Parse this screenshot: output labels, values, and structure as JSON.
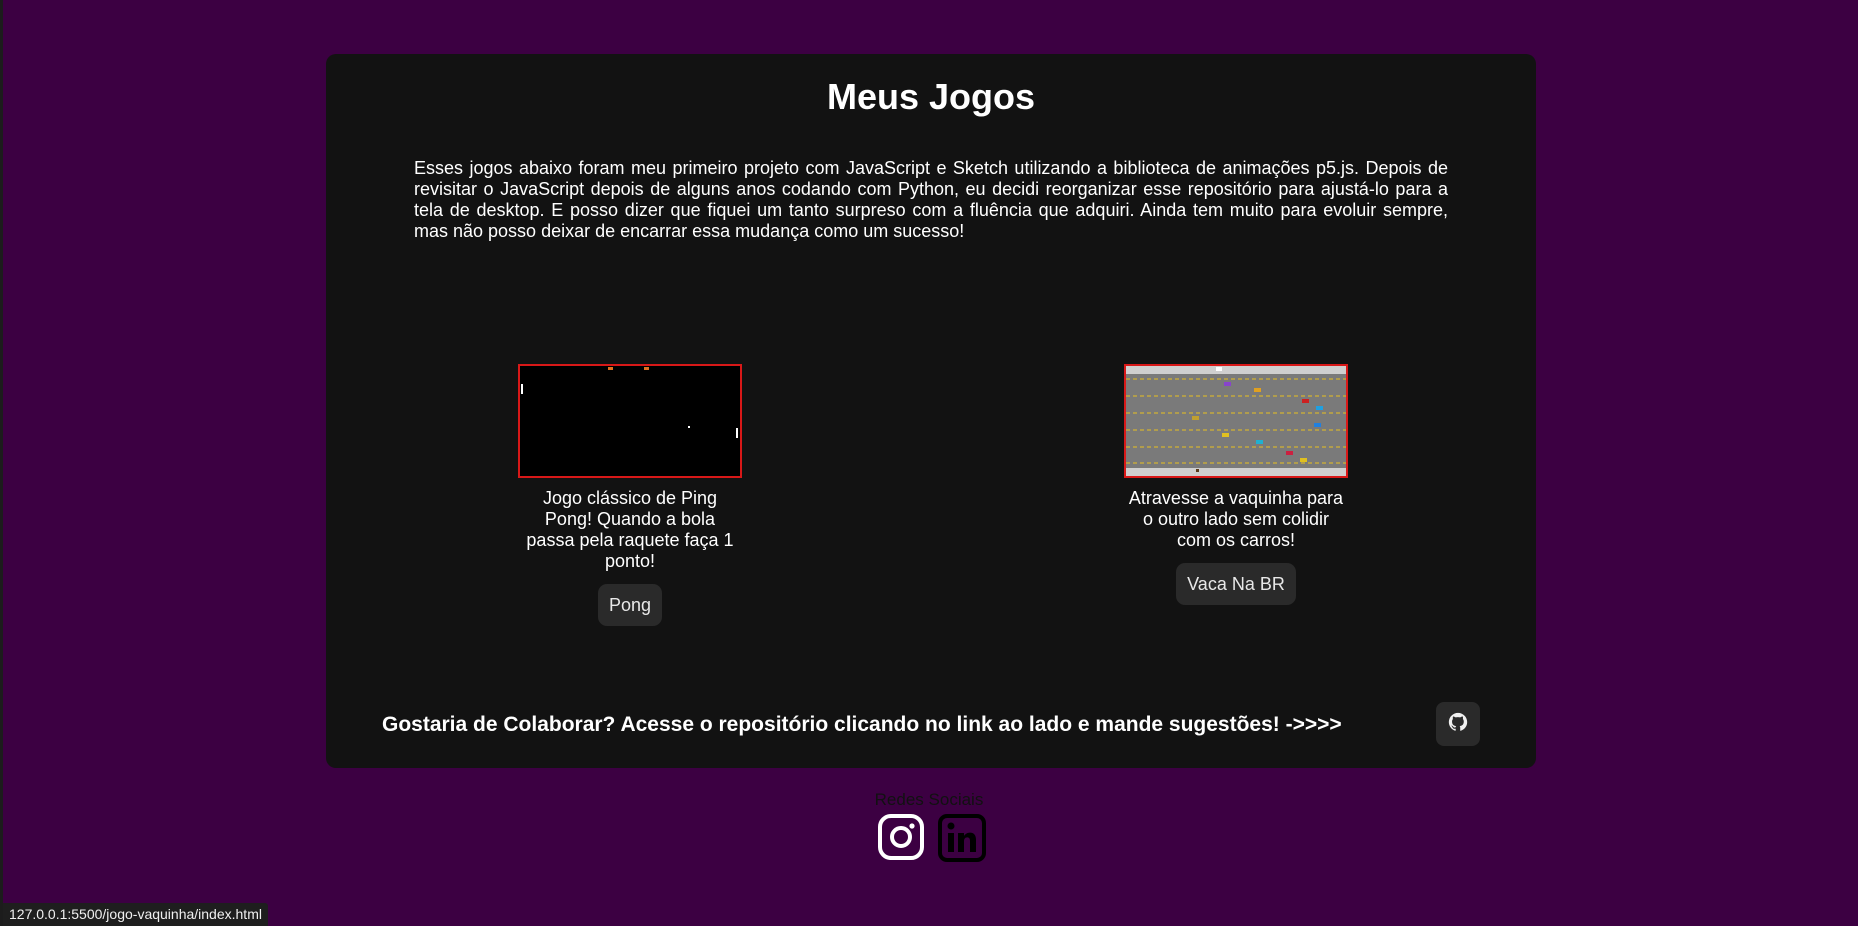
{
  "page": {
    "title": "Meus Jogos",
    "intro": "Esses jogos abaixo foram meu primeiro projeto com JavaScript e Sketch utilizando a biblioteca de animações p5.js. Depois de revisitar o JavaScript depois de alguns anos codando com Python, eu decidi reorganizar esse repositório para ajustá-lo para a tela de desktop. E posso dizer que fiquei um tanto surpreso com a fluência que adquiri. Ainda tem muito para evoluir sempre, mas não posso deixar de encarrar essa mudança como um sucesso!"
  },
  "games": [
    {
      "description": "Jogo clássico de Ping Pong! Quando a bola passa pela raquete faça 1 ponto!",
      "button_label": "Pong",
      "icon": "pong-thumbnail"
    },
    {
      "description": "Atravesse a vaquinha para o outro lado sem colidir com os carros!",
      "button_label": "Vaca Na BR",
      "icon": "vaca-thumbnail"
    }
  ],
  "collaborate": {
    "text": "Gostaria de Colaborar? Acesse o repositório clicando no link ao lado e mande sugestões! ->>>>",
    "icon": "github-icon"
  },
  "social": {
    "title": "Redes Sociais",
    "icons": [
      "instagram-icon",
      "linkedin-icon"
    ]
  },
  "status_bar": {
    "url": "127.0.0.1:5500/jogo-vaquinha/index.html"
  },
  "colors": {
    "background": "#3c0042",
    "card": "#121212",
    "thumb_border": "#d81818",
    "button": "#2a2a2a"
  }
}
